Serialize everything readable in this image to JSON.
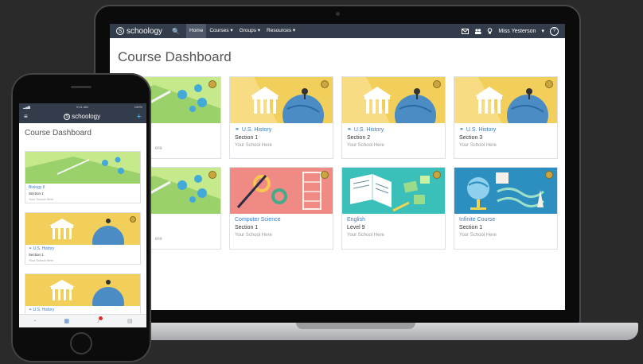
{
  "laptop": {
    "navbar": {
      "brand": "schoology",
      "brand_letter": "S",
      "search_icon": "🔍",
      "items": [
        {
          "label": "Home",
          "active": true
        },
        {
          "label": "Courses ▾",
          "active": false
        },
        {
          "label": "Groups ▾",
          "active": false
        },
        {
          "label": "Resources ▾",
          "active": false
        }
      ],
      "user_name": "Miss Yesterson",
      "user_menu_icon": "▾",
      "help_icon": "?"
    },
    "page_title": "Course Dashboard",
    "courses": [
      {
        "course": "",
        "section": "",
        "school": "ere",
        "theme": "biology"
      },
      {
        "course": "U.S. History",
        "section": "Section 1",
        "school": "Your School Here",
        "theme": "history"
      },
      {
        "course": "U.S. History",
        "section": "Section 2",
        "school": "Your School Here",
        "theme": "history"
      },
      {
        "course": "U.S. History",
        "section": "Section 3",
        "school": "Your School Here",
        "theme": "history"
      },
      {
        "course": "",
        "section": "",
        "school": "ere",
        "theme": "biology"
      },
      {
        "course": "Computer Science",
        "section": "Section 1",
        "school": "Your School Here",
        "theme": "cs"
      },
      {
        "course": "English",
        "section": "Level 9",
        "school": "Your School Here",
        "theme": "english"
      },
      {
        "course": "Infinite Course",
        "section": "Section 1",
        "school": "Your School Here",
        "theme": "infinite"
      }
    ]
  },
  "phone": {
    "status_time": "9:41 AM",
    "status_battery": "100%",
    "brand": "schoology",
    "brand_letter": "S",
    "menu_icon": "≡",
    "add_icon": "+",
    "page_title": "Course Dashboard",
    "courses": [
      {
        "course": "Biology II",
        "section": "Section 1",
        "school": "Your School Here",
        "theme": "biology"
      },
      {
        "course": "U.S. History",
        "section": "Section 1",
        "school": "Your School Here",
        "theme": "history"
      },
      {
        "course": "U.S. History",
        "section": "",
        "school": "",
        "theme": "history"
      }
    ],
    "notification_count": "1"
  },
  "colors": {
    "navbar": "#333c4a",
    "link": "#3a7bc8",
    "history_bg": "#f2cf5b",
    "biology_bg": "#c6e98c",
    "cs_bg": "#ef8a84",
    "english_bg": "#3bbfb9",
    "infinite_bg": "#2c8fbf"
  }
}
